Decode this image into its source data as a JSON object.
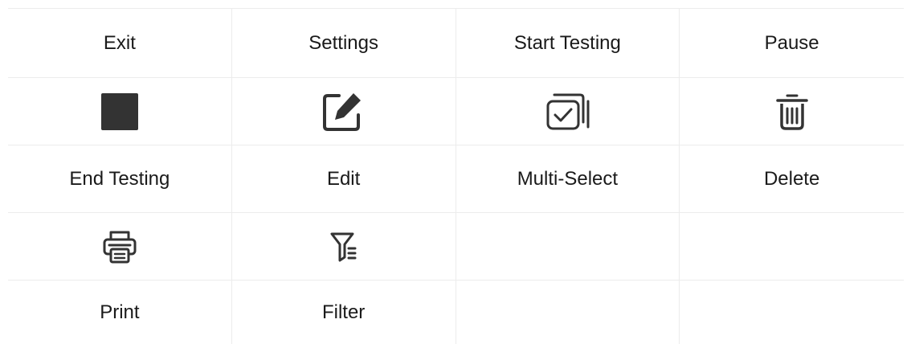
{
  "rows": {
    "row1": {
      "exit_label": "Exit",
      "settings_label": "Settings",
      "start_testing_label": "Start Testing",
      "pause_label": "Pause"
    },
    "row2": {
      "end_testing_label": "End Testing",
      "edit_label": "Edit",
      "multi_select_label": "Multi-Select",
      "delete_label": "Delete"
    },
    "row3": {
      "print_label": "Print",
      "filter_label": "Filter"
    }
  },
  "icons": {
    "end_testing": "stop-square-icon",
    "edit": "edit-pencil-icon",
    "multi_select": "multi-select-checkbox-icon",
    "delete": "trash-icon",
    "print": "printer-icon",
    "filter": "filter-funnel-icon"
  },
  "colors": {
    "icon": "#333333",
    "text": "#1a1a1a",
    "divider": "#ececec"
  }
}
